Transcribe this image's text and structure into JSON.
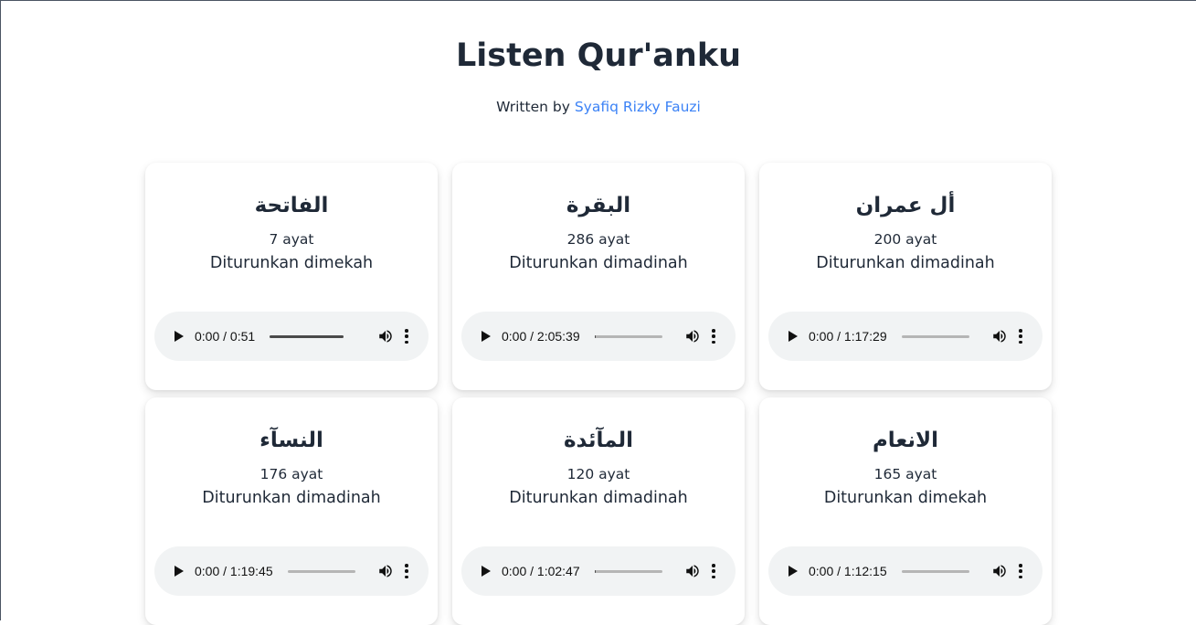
{
  "header": {
    "title": "Listen Qur'anku",
    "written_by": "Written by",
    "author": "Syafiq Rizky Fauzi"
  },
  "surahs": [
    {
      "name": "الفاتحة",
      "ayat": "7 ayat",
      "revealed": "Diturunkan dimekah",
      "time": "0:00 / 0:51",
      "progress": 1.0
    },
    {
      "name": "البقرة",
      "ayat": "286 ayat",
      "revealed": "Diturunkan dimadinah",
      "time": "0:00 / 2:05:39",
      "progress": 0.02
    },
    {
      "name": "أل عمران",
      "ayat": "200 ayat",
      "revealed": "Diturunkan dimadinah",
      "time": "0:00 / 1:17:29",
      "progress": 0.0
    },
    {
      "name": "النسآء",
      "ayat": "176 ayat",
      "revealed": "Diturunkan dimadinah",
      "time": "0:00 / 1:19:45",
      "progress": 0.0
    },
    {
      "name": "المآئدة",
      "ayat": "120 ayat",
      "revealed": "Diturunkan dimadinah",
      "time": "0:00 / 1:02:47",
      "progress": 0.02
    },
    {
      "name": "الانعام",
      "ayat": "165 ayat",
      "revealed": "Diturunkan dimekah",
      "time": "0:00 / 1:12:15",
      "progress": 0.0
    }
  ],
  "icons": {
    "play": "play-icon",
    "volume": "volume-icon",
    "more": "more-options-icon"
  },
  "colors": {
    "link": "#3b82f6",
    "player_bg": "#f1f3f4",
    "text": "#1f2937"
  }
}
